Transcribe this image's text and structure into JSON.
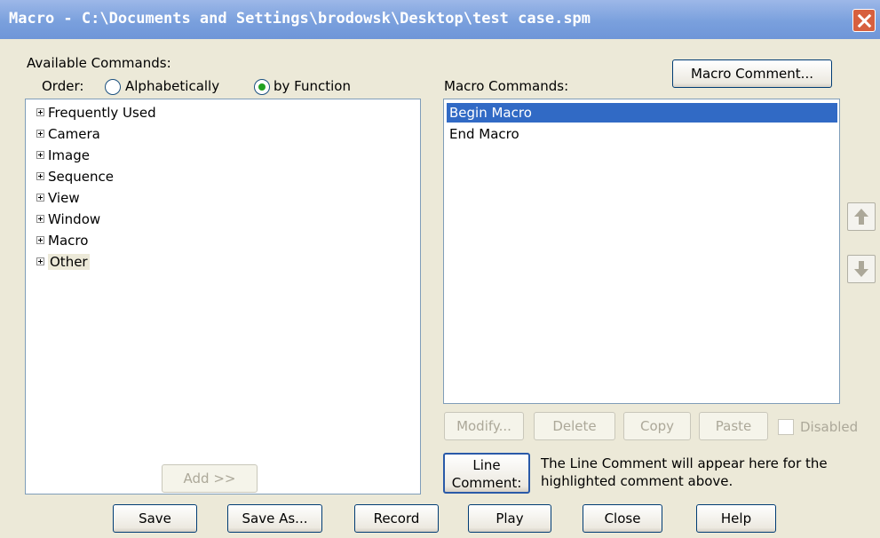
{
  "window": {
    "title": "Macro - C:\\Documents and Settings\\brodowsk\\Desktop\\test case.spm"
  },
  "available": {
    "label": "Available Commands:",
    "order_label": "Order:",
    "order_options": [
      "Alphabetically",
      "by Function"
    ],
    "selected_order": "by Function",
    "tree": [
      "Frequently Used",
      "Camera",
      "Image",
      "Sequence",
      "View",
      "Window",
      "Macro",
      "Other"
    ],
    "add_button": "Add >>"
  },
  "macro": {
    "comment_button": "Macro Comment...",
    "commands_label": "Macro Commands:",
    "commands": [
      "Begin Macro",
      "End Macro"
    ],
    "selected_command": "Begin Macro",
    "edit_buttons": {
      "modify": "Modify...",
      "delete": "Delete",
      "copy": "Copy",
      "paste": "Paste"
    },
    "disabled_label": "Disabled",
    "line_comment_button_line1": "Line",
    "line_comment_button_line2": "Comment:",
    "line_comment_text_line1": "The Line Comment will appear here for the",
    "line_comment_text_line2": "highlighted comment above."
  },
  "footer": {
    "save": "Save",
    "save_as": "Save As...",
    "record": "Record",
    "play": "Play",
    "close": "Close",
    "help": "Help"
  },
  "colors": {
    "title_gradient_top": "#9db8e8",
    "selection": "#316ac5",
    "dialog_bg": "#ece9d8"
  },
  "icons": {
    "close": "close-icon",
    "move_up": "arrow-up-icon",
    "move_down": "arrow-down-icon",
    "expand": "plus-box-icon"
  }
}
